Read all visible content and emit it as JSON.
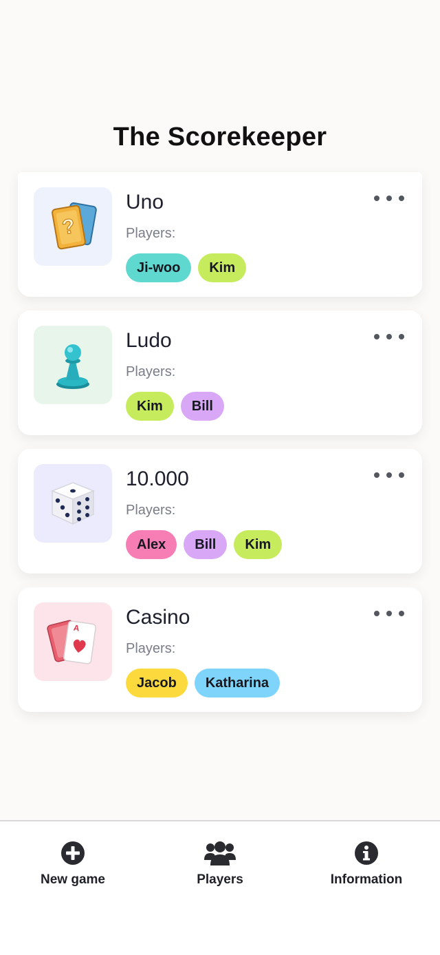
{
  "app": {
    "title": "The Scorekeeper"
  },
  "games": [
    {
      "name": "Uno",
      "players_label": "Players:",
      "icon": "question-card-icon",
      "thumb_bg": "#edf2fd",
      "players": [
        {
          "name": "Ji-woo",
          "color": "#5fd8cf"
        },
        {
          "name": "Kim",
          "color": "#c6eb5c"
        }
      ]
    },
    {
      "name": "Ludo",
      "players_label": "Players:",
      "icon": "pawn-icon",
      "thumb_bg": "#e8f5ea",
      "players": [
        {
          "name": "Kim",
          "color": "#c6eb5c"
        },
        {
          "name": "Bill",
          "color": "#d8a8f7"
        }
      ]
    },
    {
      "name": "10.000",
      "players_label": "Players:",
      "icon": "dice-icon",
      "thumb_bg": "#ecebfd",
      "players": [
        {
          "name": "Alex",
          "color": "#f77db5"
        },
        {
          "name": "Bill",
          "color": "#d8a8f7"
        },
        {
          "name": "Kim",
          "color": "#c6eb5c"
        }
      ]
    },
    {
      "name": "Casino",
      "players_label": "Players:",
      "icon": "playing-cards-icon",
      "thumb_bg": "#fde4ea",
      "players": [
        {
          "name": "Jacob",
          "color": "#fcd93c"
        },
        {
          "name": "Katharina",
          "color": "#7fd4fb"
        }
      ]
    }
  ],
  "nav": {
    "items": [
      {
        "label": "New game",
        "icon": "plus-circle-icon"
      },
      {
        "label": "Players",
        "icon": "users-icon"
      },
      {
        "label": "Information",
        "icon": "info-circle-icon"
      }
    ]
  }
}
